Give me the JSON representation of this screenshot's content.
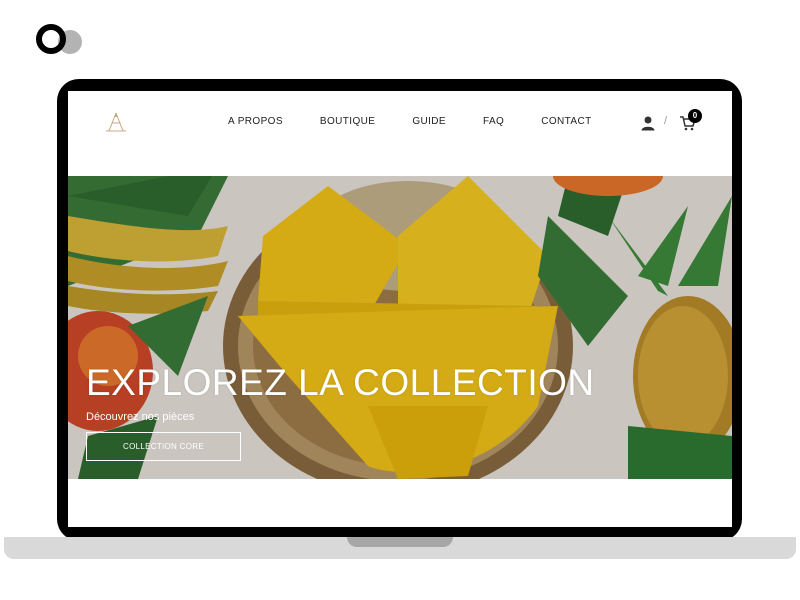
{
  "nav": {
    "items": [
      {
        "label": "A PROPOS"
      },
      {
        "label": "BOUTIQUE"
      },
      {
        "label": "GUIDE"
      },
      {
        "label": "FAQ"
      },
      {
        "label": "CONTACT"
      }
    ],
    "separator": "/",
    "cart_count": "0"
  },
  "hero": {
    "title": "EXPLOREZ LA COLLECTION",
    "subtitle": "Découvrez nos pièces",
    "button_label": "COLLECTION CORE"
  },
  "colors": {
    "accent_yellow": "#f2c318",
    "text_dark": "#222222",
    "laptop_frame": "#000000",
    "laptop_base": "#d9d9d9"
  },
  "icons": [
    "brand-logo-icon",
    "site-logo-icon",
    "user-icon",
    "cart-icon"
  ]
}
